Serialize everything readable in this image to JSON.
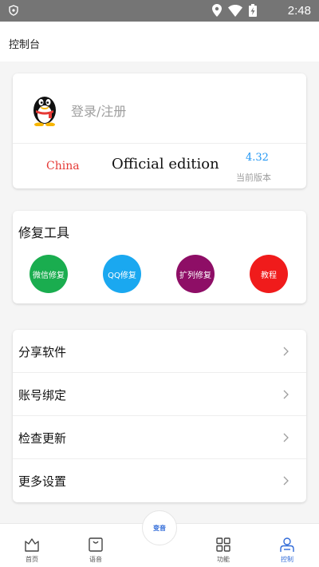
{
  "status_bar": {
    "time": "2:48",
    "icons": [
      "shield-icon",
      "location-icon",
      "wifi-icon",
      "battery-charging-icon"
    ]
  },
  "header": {
    "title": "控制台"
  },
  "login_card": {
    "avatar_icon": "qq-penguin-icon",
    "login_text": "登录/注册",
    "region": "China",
    "edition": "Official edition",
    "version": "4.32",
    "version_label": "当前版本"
  },
  "tools_card": {
    "title": "修复工具",
    "buttons": [
      {
        "label": "微信修复",
        "color": "#1aad4f"
      },
      {
        "label": "QQ修复",
        "color": "#1aa8f0"
      },
      {
        "label": "扩列修复",
        "color": "#8e0e66"
      },
      {
        "label": "教程",
        "color": "#f01b1b"
      }
    ]
  },
  "menu": {
    "items": [
      {
        "label": "分享软件"
      },
      {
        "label": "账号绑定"
      },
      {
        "label": "检查更新"
      },
      {
        "label": "更多设置"
      }
    ]
  },
  "bottom_nav": {
    "voice_label": "变音",
    "items": [
      {
        "label": "首页",
        "icon": "home-icon"
      },
      {
        "label": "语音",
        "icon": "bag-icon"
      },
      {
        "label": "功能",
        "icon": "grid-icon"
      },
      {
        "label": "控制",
        "icon": "user-icon"
      }
    ],
    "active_color": "#2f6ad8"
  }
}
